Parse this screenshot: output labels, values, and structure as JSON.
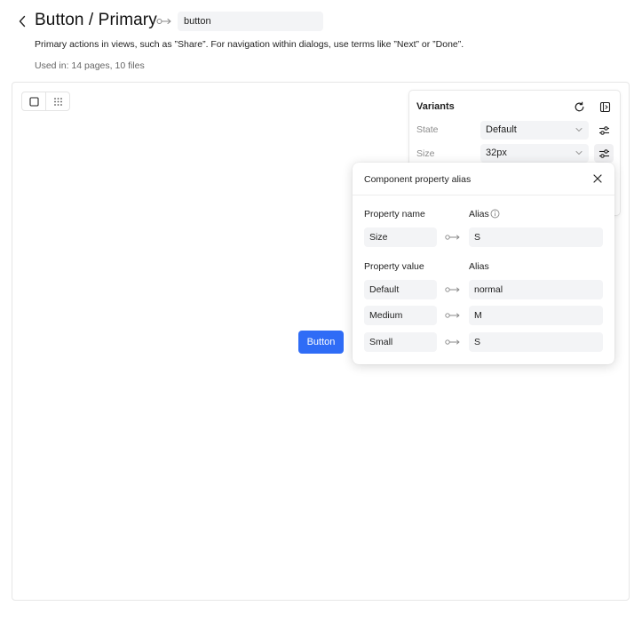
{
  "header": {
    "title": "Button / Primary",
    "alias_value": "button",
    "description": "Primary actions in views, such as ”Share”. For navigation within dialogs, use terms like ”Next” or ”Done”.",
    "used_in": "Used in: 14 pages, 10 files"
  },
  "canvas": {
    "preview_button_label": "Button"
  },
  "variants": {
    "title": "Variants",
    "rows": [
      {
        "label": "State",
        "value": "Default"
      },
      {
        "label": "Size",
        "value": "32px"
      }
    ]
  },
  "alias_popover": {
    "title": "Component property alias",
    "property_name_header": "Property name",
    "alias_header": "Alias",
    "property": {
      "name": "Size",
      "alias": "S"
    },
    "property_value_header": "Property value",
    "value_alias_header": "Alias",
    "values": [
      {
        "name": "Default",
        "alias": "normal"
      },
      {
        "name": "Medium",
        "alias": "M"
      },
      {
        "name": "Small",
        "alias": "S"
      }
    ]
  },
  "colors": {
    "accent": "#2f6cf6",
    "field_bg": "#f3f4f6",
    "muted_text": "#8c8c8c"
  },
  "icons": [
    "chevron-left-icon",
    "link-arrow-icon",
    "frame-icon",
    "grid-dots-icon",
    "reset-icon",
    "panel-toggle-icon",
    "chevron-down-icon",
    "sliders-icon",
    "close-icon",
    "info-icon"
  ]
}
